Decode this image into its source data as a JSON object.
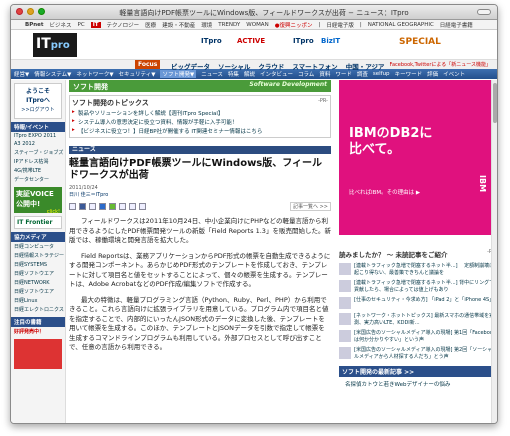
{
  "window": {
    "title": "軽量言語向けPDF帳票ツールにWindows版、フィールドワークスが出荷 − ニュース：ITpro"
  },
  "sitebar": {
    "items": [
      "BPnet",
      "ビジネス",
      "PC",
      "IT",
      "テクノロジー",
      "医療",
      "建設・不動産",
      "環境",
      "TRENDY",
      "WOMAN",
      "●復興ニッポン",
      "|",
      "日経電子版",
      "|",
      "NATIONAL GEOGRAPHIC",
      "日経電子書籍"
    ]
  },
  "logorow": {
    "logo_main": "IT",
    "logo_sub": "pro",
    "partners": [
      "ITpro",
      "ACTIVE",
      "ITpro",
      "BizIT",
      "SPECIAL"
    ]
  },
  "focus": {
    "label": "Focus",
    "links": [
      "ビッグデータ",
      "ソーシャル",
      "クラウド",
      "スマートフォン",
      "中国・アジア"
    ],
    "fb": "Facebook,Twitterによる「新ニュース機能」"
  },
  "navbar": {
    "items": [
      "経営▼",
      "情報システム▼",
      "ネットワーク▼",
      "セキュリティ▼",
      "ソフト開発▼",
      "ニュース",
      "特集",
      "解説",
      "インタビュー",
      "コラム",
      "資料",
      "ワード",
      "調査",
      "selfup",
      "キーワード",
      "評価",
      "イベント"
    ]
  },
  "sidebar": {
    "logo_line1": "ようこそ",
    "logo_line2": "ITproへ",
    "logo_line3": ">>ログアウト",
    "sec1": "特報/イベント",
    "sec1_links": [
      "ITpro EXPO 2011",
      "A3 2012",
      "スティーブ・ジョブズ",
      "IPアドレス枯渇",
      "4G/携帯LTE",
      "データセンター"
    ],
    "voice": "実証VOICE公開中!",
    "voice_click": "click!",
    "frontier": "IT Frontier",
    "sec2": "協力メディア",
    "sec2_links": [
      "日経コンピュータ",
      "日経情報ストラテジー",
      "日経SYSTEMS",
      "日経ソフトウエア",
      "日経NETWORK",
      "日経ソフトウエア",
      "日経Linux",
      "日経エレクトロニクス"
    ],
    "sec3": "注目の書籍",
    "sec3_note": "好評発売中！"
  },
  "softbar": {
    "label": "ソフト開発",
    "tag": "Software Development"
  },
  "topics": {
    "title": "ソフト開発のトピックス",
    "pr": "-PR-",
    "items": [
      "製品やソリューションを詳しく解説【週刊ITpro Special】",
      "システム導入の意思決定に役立つ資料、情報が手軽に入手可能！",
      "【ビジネスに役立つ！】日経BP社が開催する IT関連セミナー情報はこちら"
    ]
  },
  "article": {
    "section": "ニュース",
    "headline": "軽量言語向けPDF帳票ツールにWindows版、フィールドワークスが出荷",
    "date": "2011/10/24",
    "author": "日川 佳三＝ITpro",
    "more": "記事一覧へ >>",
    "paragraphs": [
      "フィールドワークスは2011年10月24日、中小企業向けにPHPなどの軽量言語から利用できるようにしたPDF帳票開発ツールの新版「Field Reports 1.3」を販売開始した。新版では、稼働環境と開発言語を拡大した。",
      "Field Reportsは、業務アプリケーションからPDF形式の帳票を自動生成できるようにする開発コンポーネント。あらかじめPDF形式のテンプレートを作成しておき、テンプレートに対して項目名と値をセットすることによって、個々の帳票を生成する。テンプレートは、Adobe AcrobatなどのPDF作成/編集ソフトで作成する。",
      "最大の特徴は、軽量プログラミング言語（Python、Ruby、Perl、PHP）から利用できること。これら言語向けに拡張ライブラリを用意している。プログラム内で項目名と値を指定することで、内部的にいったんJSON形式のデータに変換した後、テンプレートを用いて帳票を生成する。このほか、テンプレートとJSONデータを引数で指定して帳票を生成するコマンドラインプログラムも利用している。外部プロセスとして呼び出すことで、任意の言語から利用できる。"
    ]
  },
  "ad": {
    "title_line1": "IBMのDB2に",
    "title_line2": "比べて。",
    "sub": "比べればIBM。その理由は ▶",
    "brand": "IBM"
  },
  "reading": {
    "title": "読みましたか？ ～ 未読記事をご紹介",
    "pr": "-PR-",
    "items": [
      "[連載トラフィック急増で閉塞するネット半...] 　定額制崩壊は起こり得ない、最善策できちんと議論を",
      "[連載トラフィック急増で閉塞するネット半...] 背中にリングで貢献したら、場合によっては値上げもあり",
      "[仕事のセキュリティ・今求め方] 「iPad 2」と「iPhone 4S」",
      "[ネットワーク・ホットトピックス] 最新スマホの通信帯域を実測、実力高いLTE、KDDI新...",
      "[米国広告のソーシャルメディア導入の現場] 第1回「Facebookは何か分かりやすい」という声",
      "[米国広告のソーシャルメディア導入の現場] 第2回「ソーシャルメディアから人材探する人だち」とう声"
    ]
  },
  "latest": {
    "title": "ソフト開発の最新記事",
    "more": ">>",
    "item": "名探偵カトウと若きWebデザイナーの悩み"
  }
}
